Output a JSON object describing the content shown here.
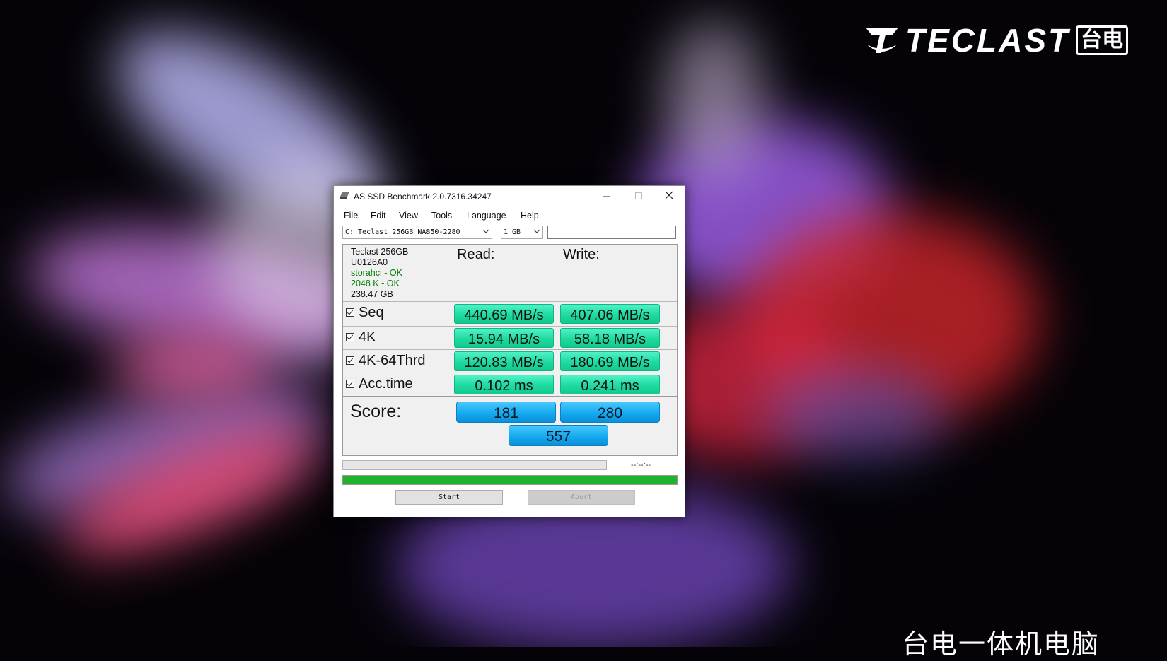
{
  "wallpaper": {
    "brand_text": "TECLAST",
    "brand_cn": "台电",
    "caption": "台电一体机电脑"
  },
  "window": {
    "title": "AS SSD Benchmark 2.0.7316.34247",
    "menu": [
      "File",
      "Edit",
      "View",
      "Tools",
      "Language",
      "Help"
    ],
    "drive_select": "C: Teclast 256GB NA850-2280",
    "size_select": "1 GB",
    "text_field": ""
  },
  "drive_info": {
    "name": "Teclast 256GB",
    "firmware": "U0126A0",
    "driver": "storahci - OK",
    "alignment": "2048 K - OK",
    "capacity": "238.47 GB"
  },
  "columns": {
    "read": "Read:",
    "write": "Write:"
  },
  "tests": [
    {
      "label": "Seq",
      "checked": true,
      "read": "440.69 MB/s",
      "write": "407.06 MB/s"
    },
    {
      "label": "4K",
      "checked": true,
      "read": "15.94 MB/s",
      "write": "58.18 MB/s"
    },
    {
      "label": "4K-64Thrd",
      "checked": true,
      "read": "120.83 MB/s",
      "write": "180.69 MB/s"
    },
    {
      "label": "Acc.time",
      "checked": true,
      "read": "0.102 ms",
      "write": "0.241 ms"
    }
  ],
  "score": {
    "label": "Score:",
    "read": "181",
    "write": "280",
    "total": "557"
  },
  "progress": {
    "current_fraction": 0,
    "overall_fraction": 1,
    "time": "--:--:--"
  },
  "buttons": {
    "start": "Start",
    "abort": "Abort"
  },
  "colors": {
    "result_green": "#1fdaa0",
    "score_blue": "#15aaf0",
    "progress_green": "#1fb22c"
  }
}
